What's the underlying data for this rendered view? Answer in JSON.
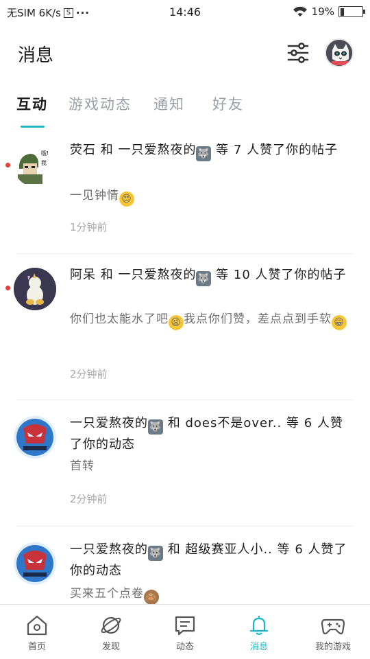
{
  "status_bar": {
    "carrier": "无SIM 6K/s",
    "sim_icon": "S",
    "dots": "···",
    "time": "14:46",
    "battery_text": "19%",
    "battery_level": 0.19
  },
  "header": {
    "title": "消息",
    "filter_icon": "sliders-icon",
    "avatar_icon": "user-avatar"
  },
  "tabs": [
    {
      "label": "互动",
      "active": true
    },
    {
      "label": "游戏动态",
      "active": false
    },
    {
      "label": "通知",
      "active": false
    },
    {
      "label": "好友",
      "active": false
    }
  ],
  "feed": [
    {
      "unread": true,
      "title_before": "荧石 和 一只爱熬夜的",
      "title_after": " 等 7 人赞了你的帖子",
      "body_before": "一见钟情",
      "body_emoji": "heart-eyes",
      "body_after": "",
      "time": "1分钟前"
    },
    {
      "unread": true,
      "title_before": "阿呆 和 一只爱熬夜的",
      "title_after": " 等 10 人赞了你的帖子",
      "body_before": "你们也太能水了吧",
      "body_emoji": "tired-face",
      "body_after": "我点你们赞，差点点到手软",
      "body_emoji2": "grin",
      "time": "2分钟前"
    },
    {
      "unread": false,
      "title_before": "一只爱熬夜的",
      "title_after": " 和 does不是over.. 等 6 人赞了你的动态",
      "body_before": "首转",
      "time": "2分钟前"
    },
    {
      "unread": false,
      "title_before": "一只爱熬夜的",
      "title_after": " 和 超级赛亚人小.. 等 6 人赞了你的动态",
      "body_before": "买来五个点卷",
      "body_emoji": "see-no-evil-monkey"
    }
  ],
  "bottom_nav": [
    {
      "label": "首页",
      "icon": "home-icon",
      "active": false
    },
    {
      "label": "发现",
      "icon": "planet-icon",
      "active": false
    },
    {
      "label": "动态",
      "icon": "chat-icon",
      "active": false
    },
    {
      "label": "消息",
      "icon": "bell-icon",
      "active": true
    },
    {
      "label": "我的游戏",
      "icon": "gamepad-icon",
      "active": false
    }
  ],
  "colors": {
    "accent": "#1bb5c5",
    "unread_dot": "#e0433c",
    "muted_text": "#a6a6a6"
  }
}
